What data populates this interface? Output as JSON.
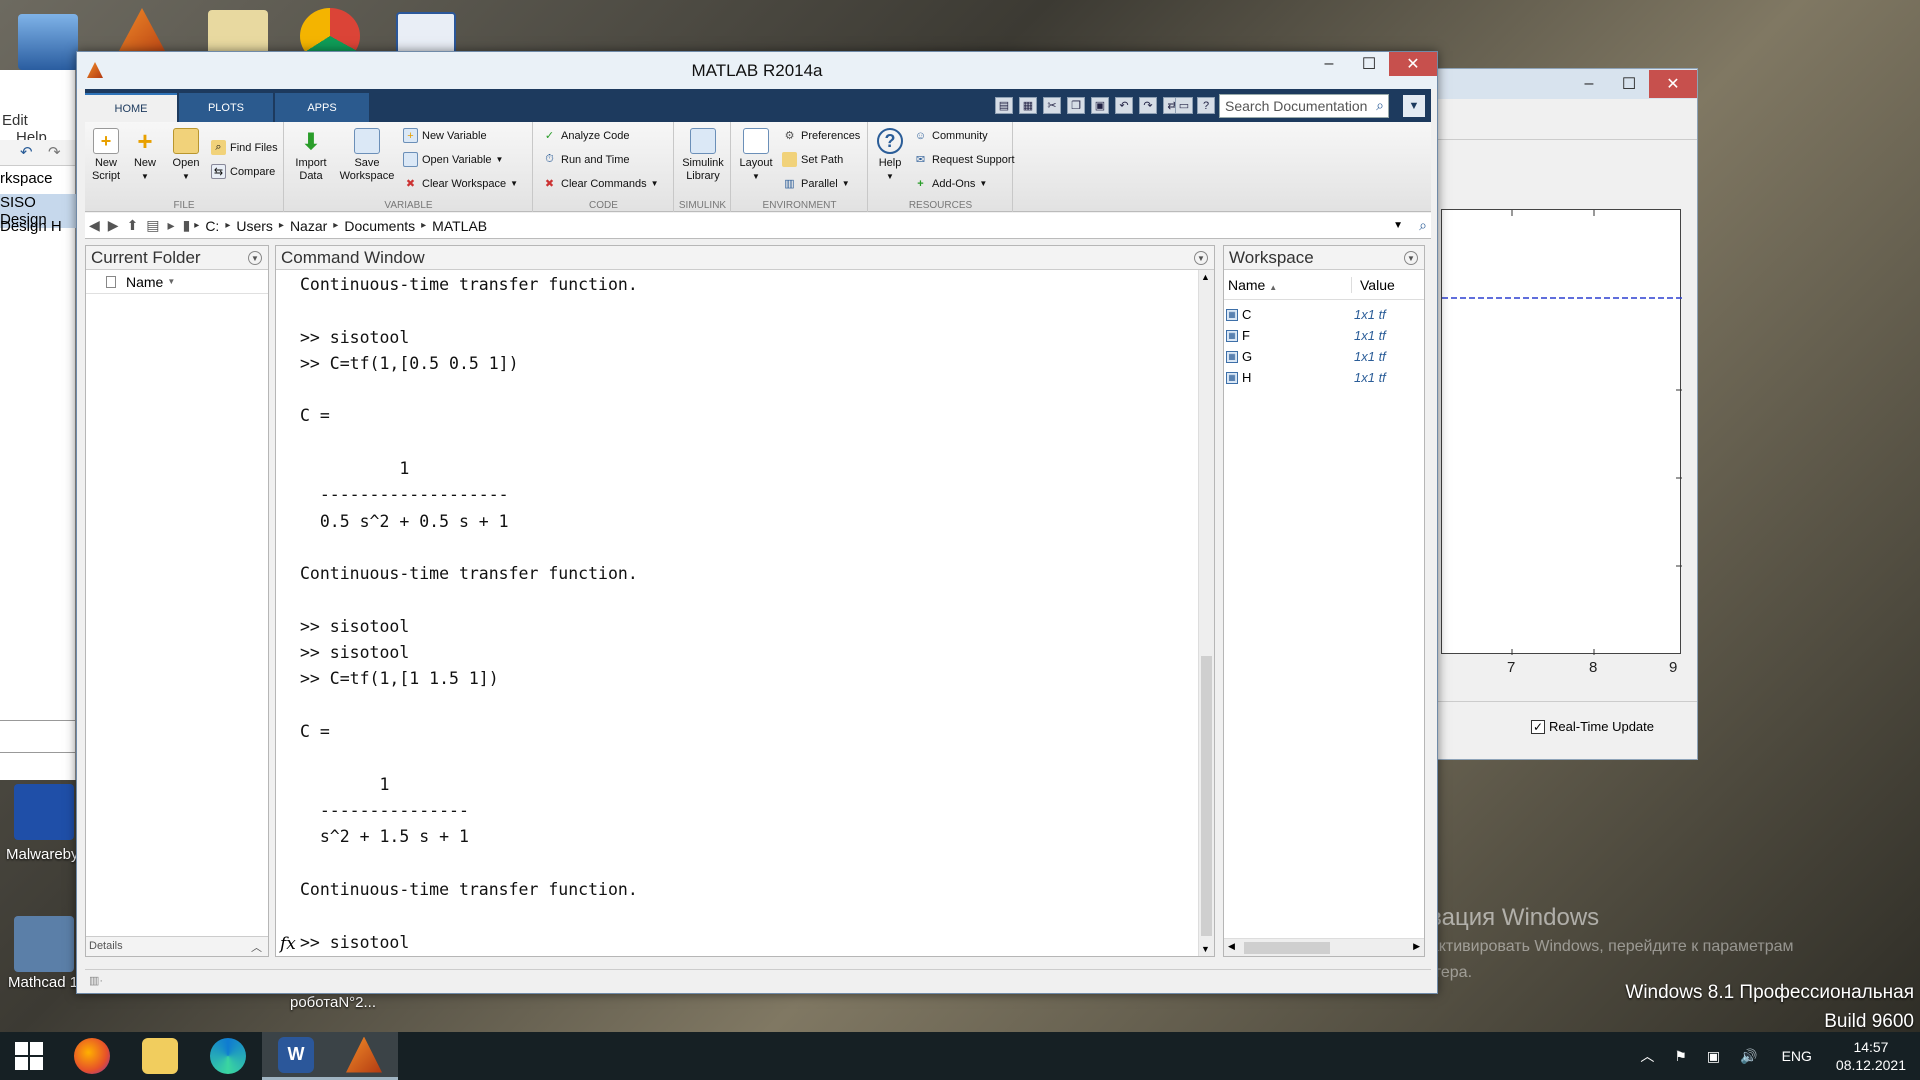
{
  "desktop": {
    "icons": [
      {
        "name": "computer-icon"
      },
      {
        "name": "matlab-desktop-icon"
      },
      {
        "name": "folder-desktop-icon"
      },
      {
        "name": "chrome-icon"
      },
      {
        "name": "word-document-icon"
      }
    ],
    "left_labels": [
      "Malwareby",
      "Mathcad 1"
    ],
    "file_label": "роботаN°2...",
    "activation": {
      "title": "Активация Windows",
      "sub1": "Чтобы активировать Windows, перейдите к параметрам",
      "sub2": "компьютера."
    },
    "edition_line1": "Windows 8.1 Профессиональная",
    "edition_line2": "Build 9600"
  },
  "left_window": {
    "menu_edit": "Edit",
    "menu_help": "Help",
    "item1": "rkspace",
    "item2": "SISO Design",
    "item3": "Design H"
  },
  "bg_window": {
    "x_ticks": [
      "7",
      "8",
      "9"
    ],
    "checkbox_label": "Real-Time Update",
    "checkbox_checked": true
  },
  "matlab": {
    "title": "MATLAB R2014a",
    "tabs": [
      "HOME",
      "PLOTS",
      "APPS"
    ],
    "search_placeholder": "Search Documentation",
    "ribbon": {
      "file": {
        "label": "FILE",
        "new_script": [
          "New",
          "Script"
        ],
        "new": "New",
        "open": "Open",
        "find_files": "Find Files",
        "compare": "Compare"
      },
      "variable": {
        "label": "VARIABLE",
        "import_data": [
          "Import",
          "Data"
        ],
        "save_workspace": [
          "Save",
          "Workspace"
        ],
        "new_variable": "New Variable",
        "open_variable": "Open Variable",
        "clear_workspace": "Clear Workspace"
      },
      "code": {
        "label": "CODE",
        "analyze_code": "Analyze Code",
        "run_and_time": "Run and Time",
        "clear_commands": "Clear Commands"
      },
      "simulink": {
        "label": "SIMULINK",
        "library": [
          "Simulink",
          "Library"
        ]
      },
      "environment": {
        "label": "ENVIRONMENT",
        "layout": "Layout",
        "preferences": "Preferences",
        "set_path": "Set Path",
        "parallel": "Parallel"
      },
      "resources": {
        "label": "RESOURCES",
        "help": "Help",
        "community": "Community",
        "request_support": "Request Support",
        "add_ons": "Add-Ons"
      }
    },
    "path": [
      "C:",
      "Users",
      "Nazar",
      "Documents",
      "MATLAB"
    ],
    "current_folder": {
      "title": "Current Folder",
      "col_name": "Name",
      "details": "Details"
    },
    "command_window": {
      "title": "Command Window",
      "lines": [
        "Continuous-time transfer function.",
        "",
        ">> sisotool",
        ">> C=tf(1,[0.5 0.5 1])",
        "",
        "C =",
        "",
        "          1",
        "  -------------------",
        "  0.5 s^2 + 0.5 s + 1",
        "",
        "Continuous-time transfer function.",
        "",
        ">> sisotool",
        ">> sisotool",
        ">> C=tf(1,[1 1.5 1])",
        "",
        "C =",
        "",
        "        1",
        "  ---------------",
        "  s^2 + 1.5 s + 1",
        "",
        "Continuous-time transfer function.",
        ""
      ],
      "prompt_line": ">> sisotool",
      "fx": "fx"
    },
    "workspace": {
      "title": "Workspace",
      "col_name": "Name",
      "col_value": "Value",
      "rows": [
        {
          "name": "C",
          "value": "1x1 tf"
        },
        {
          "name": "F",
          "value": "1x1 tf"
        },
        {
          "name": "G",
          "value": "1x1 tf"
        },
        {
          "name": "H",
          "value": "1x1 tf"
        }
      ]
    }
  },
  "taskbar": {
    "language": "ENG",
    "time": "14:57",
    "date": "08.12.2021"
  }
}
